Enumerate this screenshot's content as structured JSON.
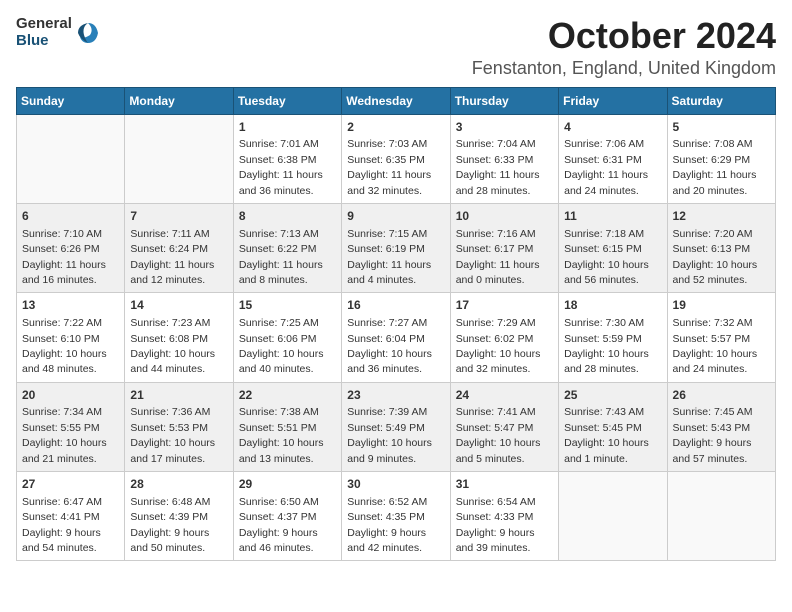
{
  "logo": {
    "general": "General",
    "blue": "Blue"
  },
  "header": {
    "month": "October 2024",
    "location": "Fenstanton, England, United Kingdom"
  },
  "days": [
    "Sunday",
    "Monday",
    "Tuesday",
    "Wednesday",
    "Thursday",
    "Friday",
    "Saturday"
  ],
  "weeks": [
    [
      {
        "day": "",
        "sunrise": "",
        "sunset": "",
        "daylight": ""
      },
      {
        "day": "",
        "sunrise": "",
        "sunset": "",
        "daylight": ""
      },
      {
        "day": "1",
        "sunrise": "Sunrise: 7:01 AM",
        "sunset": "Sunset: 6:38 PM",
        "daylight": "Daylight: 11 hours and 36 minutes."
      },
      {
        "day": "2",
        "sunrise": "Sunrise: 7:03 AM",
        "sunset": "Sunset: 6:35 PM",
        "daylight": "Daylight: 11 hours and 32 minutes."
      },
      {
        "day": "3",
        "sunrise": "Sunrise: 7:04 AM",
        "sunset": "Sunset: 6:33 PM",
        "daylight": "Daylight: 11 hours and 28 minutes."
      },
      {
        "day": "4",
        "sunrise": "Sunrise: 7:06 AM",
        "sunset": "Sunset: 6:31 PM",
        "daylight": "Daylight: 11 hours and 24 minutes."
      },
      {
        "day": "5",
        "sunrise": "Sunrise: 7:08 AM",
        "sunset": "Sunset: 6:29 PM",
        "daylight": "Daylight: 11 hours and 20 minutes."
      }
    ],
    [
      {
        "day": "6",
        "sunrise": "Sunrise: 7:10 AM",
        "sunset": "Sunset: 6:26 PM",
        "daylight": "Daylight: 11 hours and 16 minutes."
      },
      {
        "day": "7",
        "sunrise": "Sunrise: 7:11 AM",
        "sunset": "Sunset: 6:24 PM",
        "daylight": "Daylight: 11 hours and 12 minutes."
      },
      {
        "day": "8",
        "sunrise": "Sunrise: 7:13 AM",
        "sunset": "Sunset: 6:22 PM",
        "daylight": "Daylight: 11 hours and 8 minutes."
      },
      {
        "day": "9",
        "sunrise": "Sunrise: 7:15 AM",
        "sunset": "Sunset: 6:19 PM",
        "daylight": "Daylight: 11 hours and 4 minutes."
      },
      {
        "day": "10",
        "sunrise": "Sunrise: 7:16 AM",
        "sunset": "Sunset: 6:17 PM",
        "daylight": "Daylight: 11 hours and 0 minutes."
      },
      {
        "day": "11",
        "sunrise": "Sunrise: 7:18 AM",
        "sunset": "Sunset: 6:15 PM",
        "daylight": "Daylight: 10 hours and 56 minutes."
      },
      {
        "day": "12",
        "sunrise": "Sunrise: 7:20 AM",
        "sunset": "Sunset: 6:13 PM",
        "daylight": "Daylight: 10 hours and 52 minutes."
      }
    ],
    [
      {
        "day": "13",
        "sunrise": "Sunrise: 7:22 AM",
        "sunset": "Sunset: 6:10 PM",
        "daylight": "Daylight: 10 hours and 48 minutes."
      },
      {
        "day": "14",
        "sunrise": "Sunrise: 7:23 AM",
        "sunset": "Sunset: 6:08 PM",
        "daylight": "Daylight: 10 hours and 44 minutes."
      },
      {
        "day": "15",
        "sunrise": "Sunrise: 7:25 AM",
        "sunset": "Sunset: 6:06 PM",
        "daylight": "Daylight: 10 hours and 40 minutes."
      },
      {
        "day": "16",
        "sunrise": "Sunrise: 7:27 AM",
        "sunset": "Sunset: 6:04 PM",
        "daylight": "Daylight: 10 hours and 36 minutes."
      },
      {
        "day": "17",
        "sunrise": "Sunrise: 7:29 AM",
        "sunset": "Sunset: 6:02 PM",
        "daylight": "Daylight: 10 hours and 32 minutes."
      },
      {
        "day": "18",
        "sunrise": "Sunrise: 7:30 AM",
        "sunset": "Sunset: 5:59 PM",
        "daylight": "Daylight: 10 hours and 28 minutes."
      },
      {
        "day": "19",
        "sunrise": "Sunrise: 7:32 AM",
        "sunset": "Sunset: 5:57 PM",
        "daylight": "Daylight: 10 hours and 24 minutes."
      }
    ],
    [
      {
        "day": "20",
        "sunrise": "Sunrise: 7:34 AM",
        "sunset": "Sunset: 5:55 PM",
        "daylight": "Daylight: 10 hours and 21 minutes."
      },
      {
        "day": "21",
        "sunrise": "Sunrise: 7:36 AM",
        "sunset": "Sunset: 5:53 PM",
        "daylight": "Daylight: 10 hours and 17 minutes."
      },
      {
        "day": "22",
        "sunrise": "Sunrise: 7:38 AM",
        "sunset": "Sunset: 5:51 PM",
        "daylight": "Daylight: 10 hours and 13 minutes."
      },
      {
        "day": "23",
        "sunrise": "Sunrise: 7:39 AM",
        "sunset": "Sunset: 5:49 PM",
        "daylight": "Daylight: 10 hours and 9 minutes."
      },
      {
        "day": "24",
        "sunrise": "Sunrise: 7:41 AM",
        "sunset": "Sunset: 5:47 PM",
        "daylight": "Daylight: 10 hours and 5 minutes."
      },
      {
        "day": "25",
        "sunrise": "Sunrise: 7:43 AM",
        "sunset": "Sunset: 5:45 PM",
        "daylight": "Daylight: 10 hours and 1 minute."
      },
      {
        "day": "26",
        "sunrise": "Sunrise: 7:45 AM",
        "sunset": "Sunset: 5:43 PM",
        "daylight": "Daylight: 9 hours and 57 minutes."
      }
    ],
    [
      {
        "day": "27",
        "sunrise": "Sunrise: 6:47 AM",
        "sunset": "Sunset: 4:41 PM",
        "daylight": "Daylight: 9 hours and 54 minutes."
      },
      {
        "day": "28",
        "sunrise": "Sunrise: 6:48 AM",
        "sunset": "Sunset: 4:39 PM",
        "daylight": "Daylight: 9 hours and 50 minutes."
      },
      {
        "day": "29",
        "sunrise": "Sunrise: 6:50 AM",
        "sunset": "Sunset: 4:37 PM",
        "daylight": "Daylight: 9 hours and 46 minutes."
      },
      {
        "day": "30",
        "sunrise": "Sunrise: 6:52 AM",
        "sunset": "Sunset: 4:35 PM",
        "daylight": "Daylight: 9 hours and 42 minutes."
      },
      {
        "day": "31",
        "sunrise": "Sunrise: 6:54 AM",
        "sunset": "Sunset: 4:33 PM",
        "daylight": "Daylight: 9 hours and 39 minutes."
      },
      {
        "day": "",
        "sunrise": "",
        "sunset": "",
        "daylight": ""
      },
      {
        "day": "",
        "sunrise": "",
        "sunset": "",
        "daylight": ""
      }
    ]
  ]
}
